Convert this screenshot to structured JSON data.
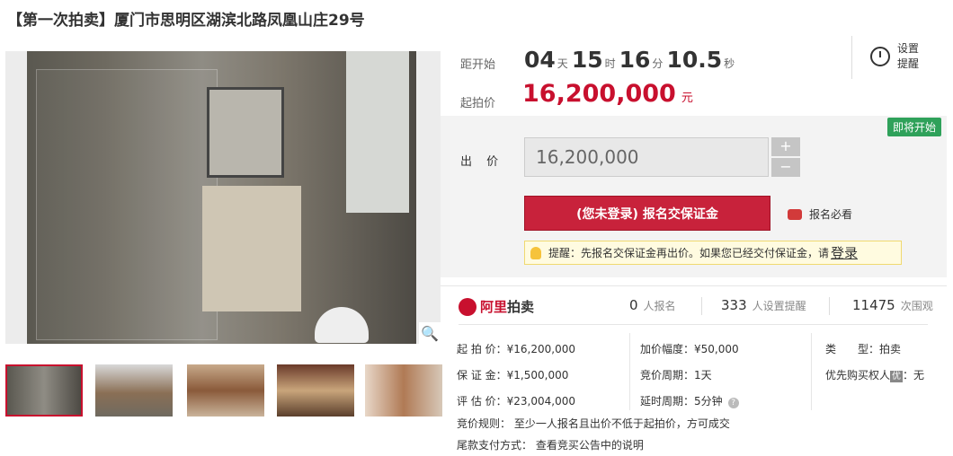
{
  "title": "【第一次拍卖】厦门市思明区湖滨北路凤凰山庄29号",
  "countdown": {
    "label": "距开始",
    "days": "04",
    "days_unit": "天",
    "hours": "15",
    "hours_unit": "时",
    "minutes": "16",
    "minutes_unit": "分",
    "seconds": "10.5",
    "seconds_unit": "秒"
  },
  "remind": {
    "label_line1": "设置",
    "label_line2": "提醒"
  },
  "start_price": {
    "label": "起拍价",
    "value": "16,200,000",
    "unit": "元"
  },
  "bid": {
    "badge": "即将开始",
    "label": "出 价",
    "input_value": "16,200,000",
    "plus": "+",
    "minus": "−",
    "signup_button": "(您未登录) 报名交保证金",
    "must_read": "报名必看",
    "tip_text": "提醒：先报名交保证金再出价。如果您已经交付保证金，请",
    "tip_login": "登录"
  },
  "brand": {
    "prefix": "阿里",
    "name": "拍卖"
  },
  "stats": [
    {
      "num": "0",
      "label": "人报名"
    },
    {
      "num": "333",
      "label": "人设置提醒"
    },
    {
      "num": "11475",
      "label": "次围观"
    }
  ],
  "info": {
    "col1": [
      {
        "k": "起 拍 价：",
        "v": "¥16,200,000"
      },
      {
        "k": "保 证 金：",
        "v": "¥1,500,000"
      },
      {
        "k": "评 估 价：",
        "v": "¥23,004,000"
      }
    ],
    "col2": [
      {
        "k": "加价幅度：",
        "v": "¥50,000"
      },
      {
        "k": "竞价周期：",
        "v": "1天"
      },
      {
        "k": "延时周期：",
        "v": "5分钟"
      }
    ],
    "col3": [
      {
        "k": "类　　型：",
        "v": "拍卖"
      },
      {
        "k": "优先购买权人",
        "pill": "优",
        "v": "：无"
      }
    ]
  },
  "rules": {
    "rule_label": "竞价规则：",
    "rule_text": "至少一人报名且出价不低于起拍价，方可成交",
    "pay_label": "尾款支付方式：",
    "pay_text": "查看竞买公告中的说明"
  },
  "icons": {
    "zoom": "magnifier-icon",
    "clock": "alarm-clock-icon",
    "coins": "coins-icon",
    "bulb": "lightbulb-icon",
    "help": "question-icon"
  },
  "colors": {
    "accent": "#c8102e",
    "badge": "#2fa15a"
  }
}
